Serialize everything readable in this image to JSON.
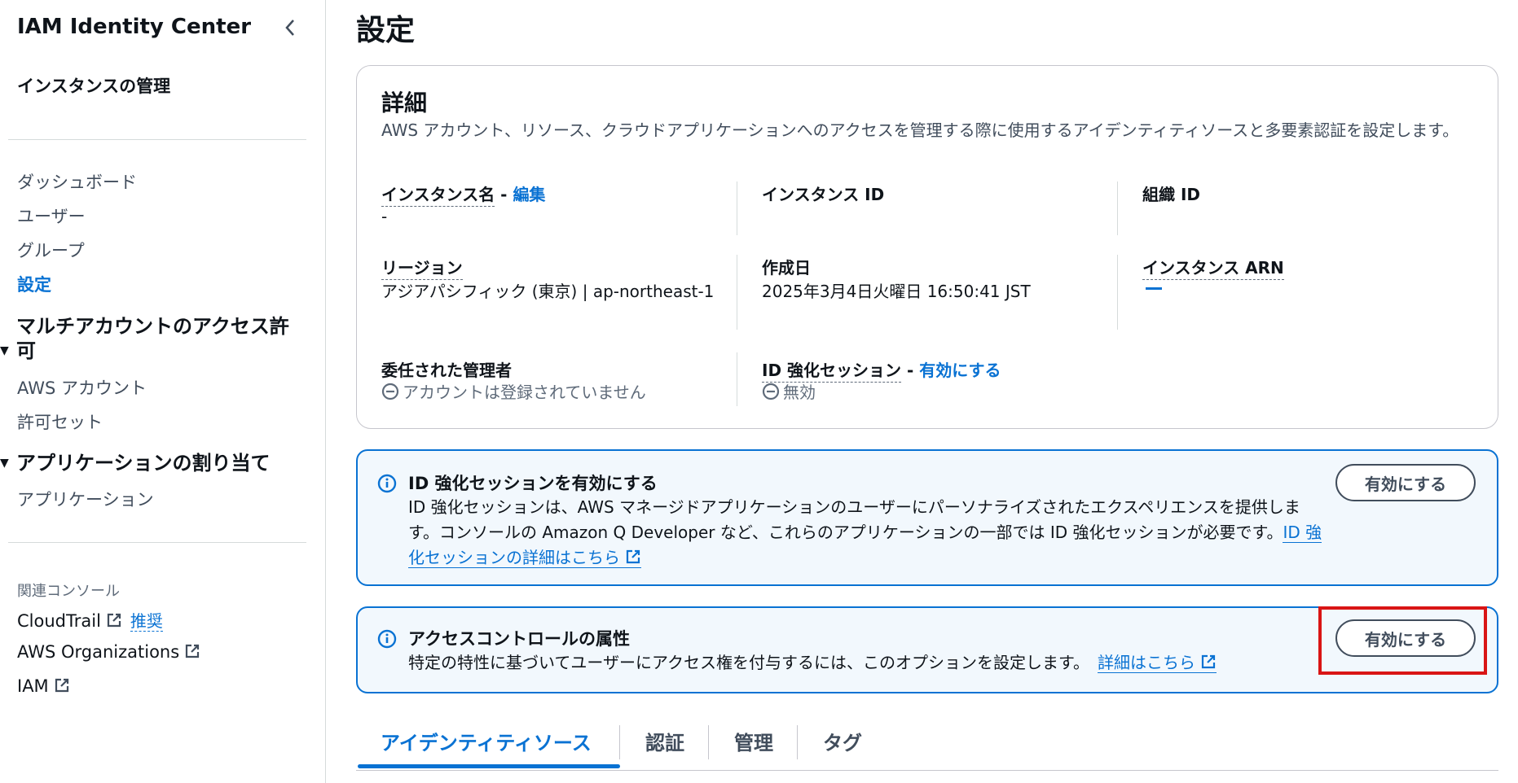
{
  "sidebar": {
    "title": "IAM Identity Center",
    "subtitle": "インスタンスの管理",
    "items": [
      {
        "label": "ダッシュボード"
      },
      {
        "label": "ユーザー"
      },
      {
        "label": "グループ"
      },
      {
        "label": "設定",
        "active": true
      }
    ],
    "sections": [
      {
        "label": "マルチアカウントのアクセス許可",
        "items": [
          {
            "label": "AWS アカウント"
          },
          {
            "label": "許可セット"
          }
        ]
      },
      {
        "label": "アプリケーションの割り当て",
        "items": [
          {
            "label": "アプリケーション"
          }
        ]
      }
    ],
    "related": {
      "heading": "関連コンソール",
      "links": [
        {
          "label": "CloudTrail",
          "badge": "推奨"
        },
        {
          "label": "AWS Organizations"
        },
        {
          "label": "IAM"
        }
      ]
    }
  },
  "page": {
    "title": "設定"
  },
  "details": {
    "title": "詳細",
    "description": "AWS アカウント、リソース、クラウドアプリケーションへのアクセスを管理する際に使用するアイデンティティソースと多要素認証を設定します。",
    "instance_name": {
      "label": "インスタンス名",
      "edit": "編集",
      "value": "-"
    },
    "instance_id": {
      "label": "インスタンス ID"
    },
    "org_id": {
      "label": "組織 ID"
    },
    "region": {
      "label": "リージョン",
      "value": "アジアパシフィック (東京) | ap-northeast-1"
    },
    "created": {
      "label": "作成日",
      "value": "2025年3月4日火曜日 16:50:41 JST"
    },
    "instance_arn": {
      "label": "インスタンス ARN"
    },
    "delegated_admin": {
      "label": "委任された管理者",
      "value": "アカウントは登録されていません"
    },
    "id_session": {
      "label": "ID 強化セッション",
      "action": "有効にする",
      "value": "無効"
    }
  },
  "alerts": [
    {
      "title": "ID 強化セッションを有効にする",
      "body": "ID 強化セッションは、AWS マネージドアプリケーションのユーザーにパーソナライズされたエクスペリエンスを提供します。コンソールの Amazon Q Developer など、これらのアプリケーションの一部では ID 強化セッションが必要です。",
      "link": "ID 強化セッションの詳細はこちら",
      "button": "有効にする"
    },
    {
      "title": "アクセスコントロールの属性",
      "body": "特定の特性に基づいてユーザーにアクセス権を付与するには、このオプションを設定します。",
      "link": "詳細はこちら",
      "button": "有効にする"
    }
  ],
  "tabs": [
    {
      "label": "アイデンティティソース",
      "active": true
    },
    {
      "label": "認証"
    },
    {
      "label": "管理"
    },
    {
      "label": "タグ"
    }
  ],
  "colors": {
    "accent": "#0972d3",
    "info_bg": "#f2f8fd",
    "highlight": "#d91515"
  }
}
